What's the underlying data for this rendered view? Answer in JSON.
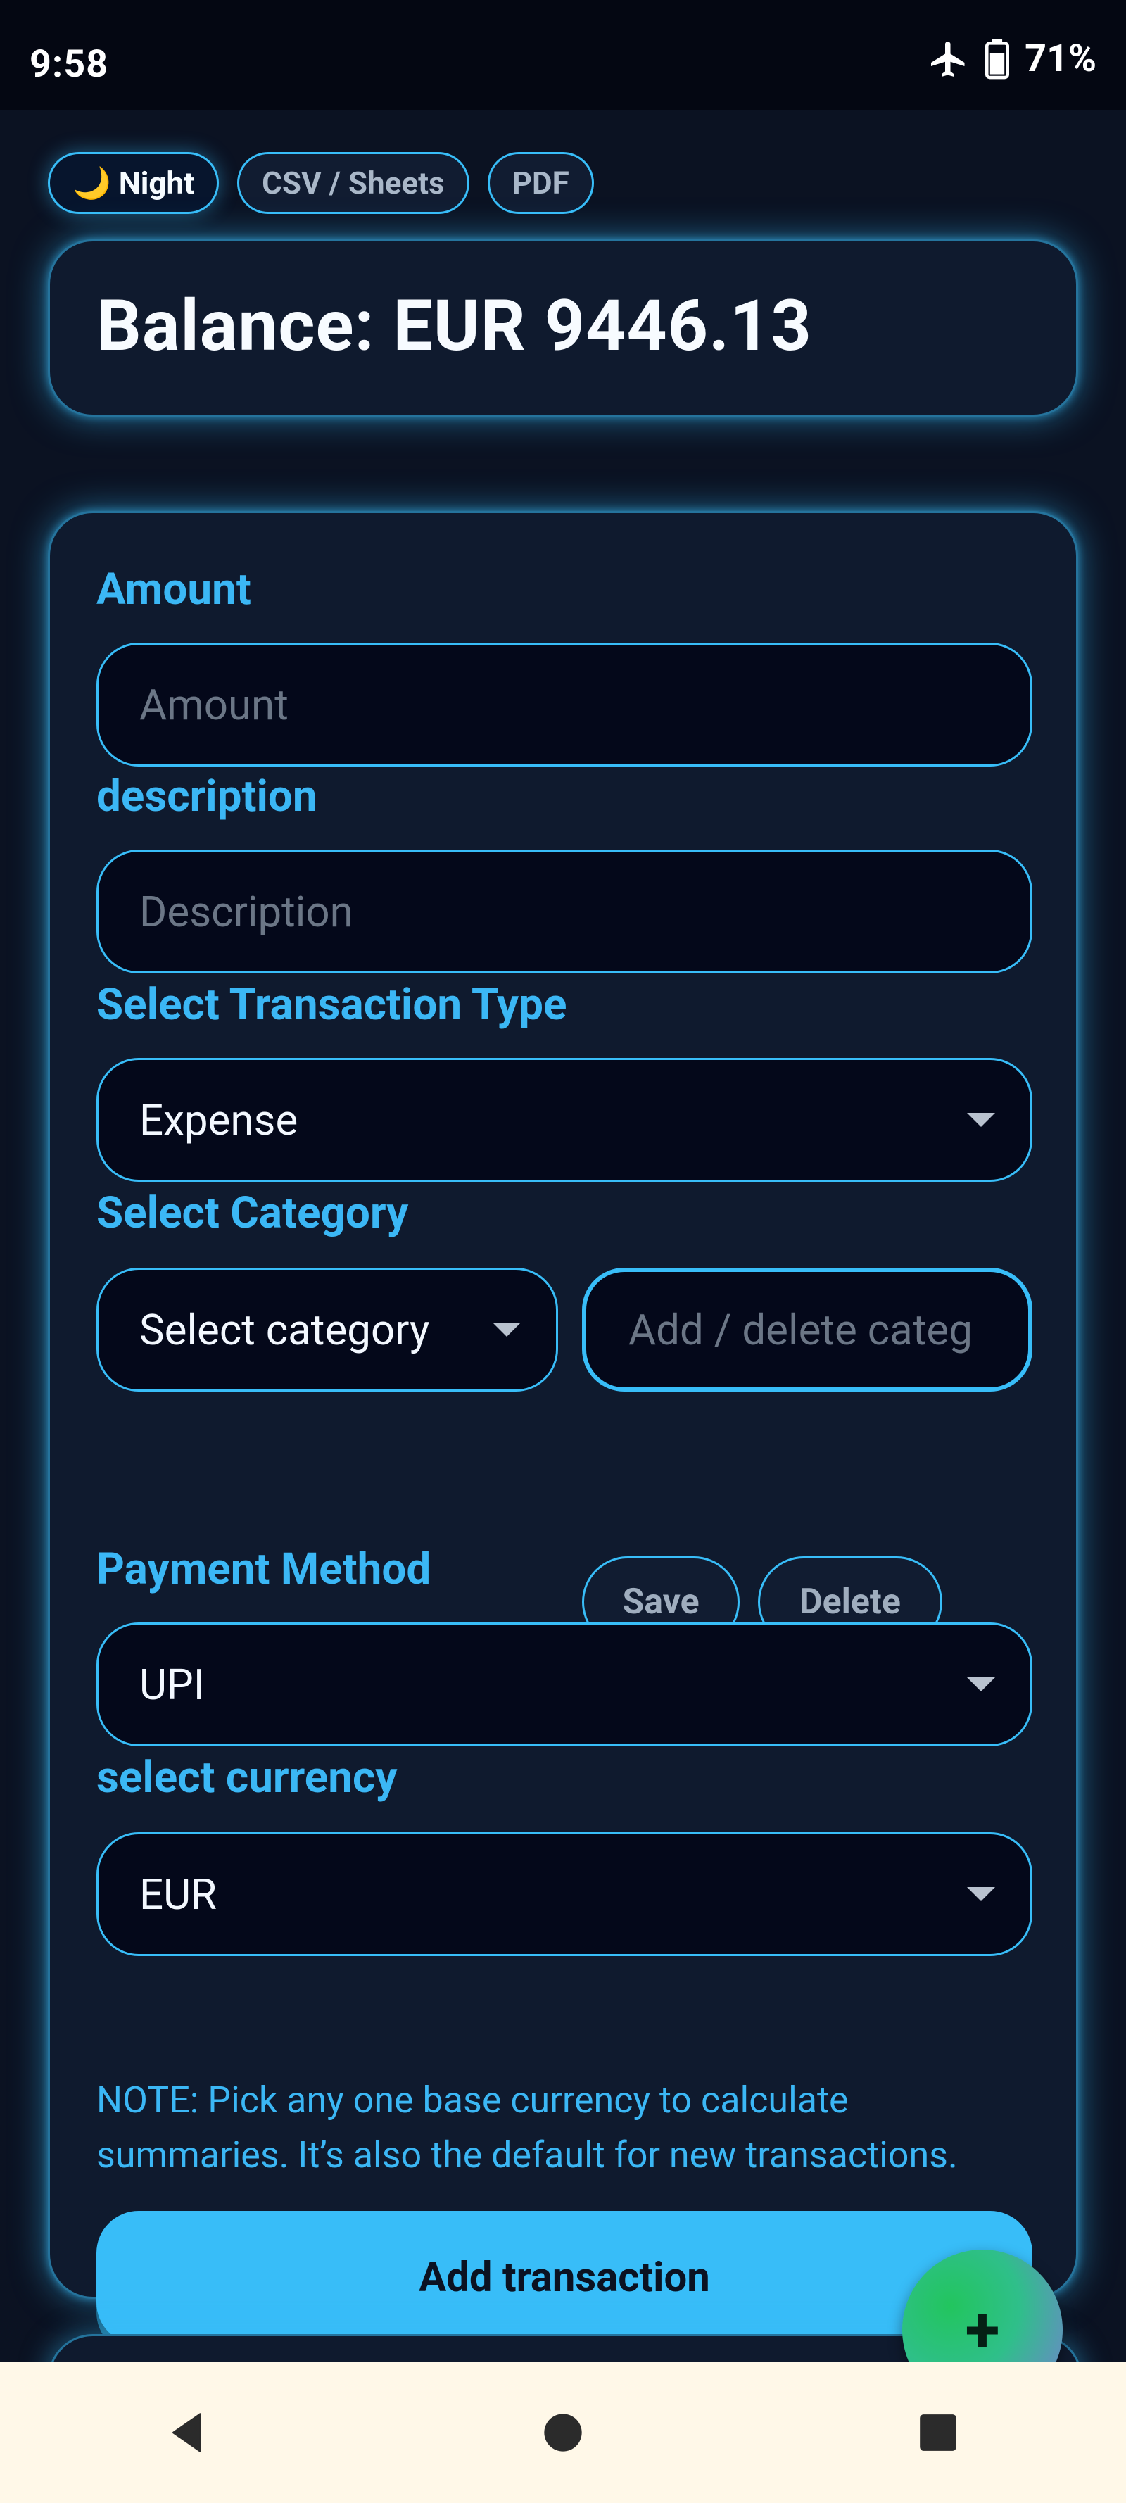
{
  "status_bar": {
    "time": "9:58",
    "battery": "71%"
  },
  "toolbar": {
    "night_label": "🌙 Night",
    "csv_label": "CSV / Sheets",
    "pdf_label": "PDF"
  },
  "balance": {
    "text": "Balance: EUR 9446.13"
  },
  "form": {
    "amount_label": "Amount",
    "amount_placeholder": "Amount",
    "description_label": "description",
    "description_placeholder": "Description",
    "type_label": "Select Transaction Type",
    "type_value": "Expense",
    "category_label": "Select Category",
    "category_value": "Select category",
    "category_input_placeholder": "Add / delete categ",
    "save_label": "Save",
    "delete_label": "Delete",
    "payment_label": "Payment Method",
    "payment_value": "UPI",
    "currency_label": "select currency",
    "currency_value": "EUR",
    "note": "NOTE: Pick any one base currency to calculate summaries. It’s also the default for new transactions.",
    "submit_label": "Add transaction"
  },
  "fab": {
    "label": "+"
  },
  "colors": {
    "accent": "#38bdf8",
    "background": "#0b1222",
    "card": "#0f1a2e",
    "fab": "#22c55e"
  },
  "icons": [
    "airplane-icon",
    "battery-icon",
    "moon-icon",
    "back-icon",
    "home-icon",
    "recents-icon",
    "caret-down-icon",
    "plus-icon"
  ]
}
